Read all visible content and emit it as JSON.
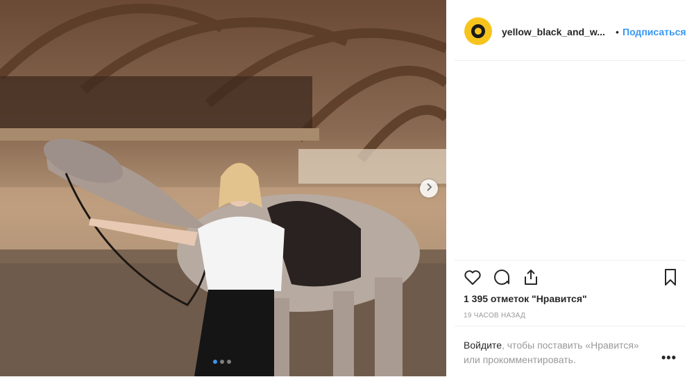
{
  "post": {
    "username": "yellow_black_and_w...",
    "separator": "•",
    "follow_label": "Подписаться",
    "likes_text": "1 395 отметок \"Нравится\"",
    "time_text": "19 ЧАСОВ НАЗАД",
    "login_link": "Войдите",
    "login_rest": ", чтобы поставить «Нравится» или прокомментировать.",
    "more_label": "•••",
    "carousel_count": 3,
    "carousel_active": 1
  },
  "icons": {
    "like": "heart-icon",
    "comment": "comment-icon",
    "share": "share-icon",
    "save": "bookmark-icon",
    "next": "chevron-right-icon"
  },
  "colors": {
    "accent": "#3897f0",
    "avatar_bg": "#f7c41e",
    "text": "#262626",
    "muted": "#999999"
  }
}
